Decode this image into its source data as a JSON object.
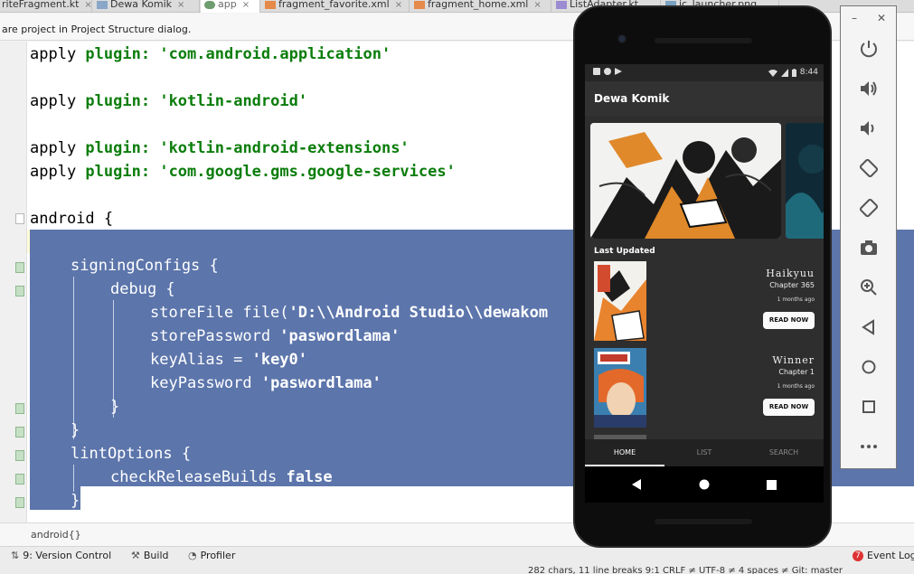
{
  "editor_tabs": [
    {
      "label": "riteFragment.kt"
    },
    {
      "label": "Dewa Komik"
    },
    {
      "label": "app"
    },
    {
      "label": "fragment_favorite.xml"
    },
    {
      "label": "fragment_home.xml"
    },
    {
      "label": "ListAdapter.kt"
    },
    {
      "label": "ic_launcher.png"
    }
  ],
  "notice": {
    "text": "are project in Project Structure dialog."
  },
  "code": {
    "line1": {
      "ident": "apply ",
      "kw": "plugin:",
      "sp": " ",
      "str": "'com.android.application'"
    },
    "line2": {
      "ident": "apply ",
      "kw": "plugin:",
      "sp": " ",
      "str": "'kotlin-android'"
    },
    "line3": {
      "ident": "apply ",
      "kw": "plugin:",
      "sp": " ",
      "str": "'kotlin-android-extensions'"
    },
    "line4": {
      "ident": "apply ",
      "kw": "plugin:",
      "sp": " ",
      "str": "'com.google.gms.google-services'"
    },
    "line5": {
      "text": "android {"
    },
    "line6": {
      "text": "signingConfigs {"
    },
    "line7": {
      "text": "debug {"
    },
    "line8": {
      "a": "storeFile file(",
      "b": "'D:\\\\Android Studio\\\\dewakom"
    },
    "line9": {
      "a": "storePassword ",
      "b": "'paswordlama'"
    },
    "line10": {
      "a": "keyAlias = ",
      "b": "'key0'"
    },
    "line11": {
      "a": "keyPassword ",
      "b": "'paswordlama'"
    },
    "line12": {
      "text": "}"
    },
    "line13": {
      "text": "}"
    },
    "line14": {
      "text": "lintOptions {"
    },
    "line15": {
      "a": "checkReleaseBuilds ",
      "b": "false"
    },
    "line16": {
      "text": "}"
    }
  },
  "breadcrumb": {
    "text": "android{}"
  },
  "tool_windows": {
    "version_control": "9: Version Control",
    "build": "Build",
    "profiler": "Profiler",
    "event_log": "Event Log",
    "event_count": "7"
  },
  "status_bar": {
    "text": "282 chars, 11 line breaks   9:1   CRLF ≠   UTF-8 ≠   4 spaces ≠   Git: master"
  },
  "emulator_window": {
    "minimize": "–",
    "close": "✕"
  },
  "phone": {
    "status_time": "8:44",
    "app_title": "Dewa Komik",
    "section_title": "Last Updated",
    "items": [
      {
        "title": "Haikyuu",
        "chapter": "Chapter 365",
        "updated": "1 months ago",
        "button": "READ NOW"
      },
      {
        "title": "Winner",
        "chapter": "Chapter 1",
        "updated": "1 months ago",
        "button": "READ NOW"
      }
    ],
    "bottom_nav": [
      {
        "label": "HOME",
        "active": true
      },
      {
        "label": "LIST",
        "active": false
      },
      {
        "label": "SEARCH",
        "active": false
      }
    ]
  },
  "colors": {
    "selection": "#5c75ab",
    "keyword": "#0b7d0b",
    "phone_bg": "#2e2e2e"
  }
}
